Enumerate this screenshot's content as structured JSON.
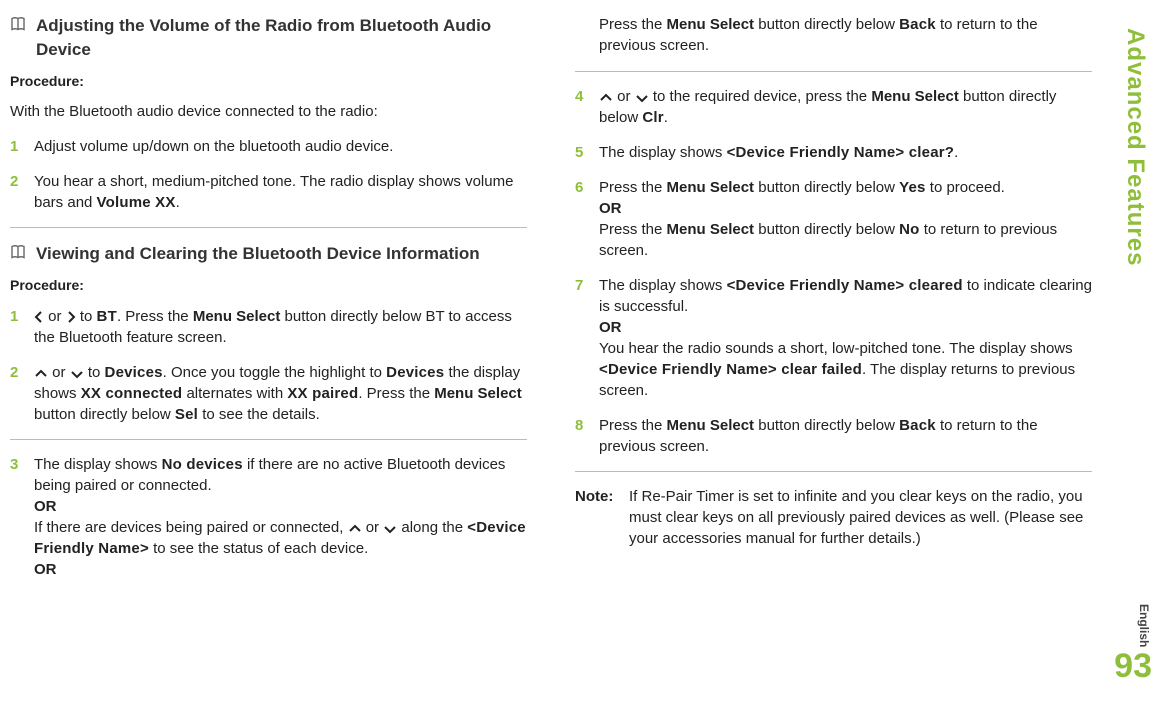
{
  "sideTab": "Advanced Features",
  "langTag": "English",
  "pageNumber": "93",
  "icons": {
    "book": "book-icon",
    "left": "nav-left-caret-icon",
    "right": "nav-right-caret-icon",
    "up": "nav-up-caret-icon",
    "down": "nav-down-caret-icon"
  },
  "col1": {
    "section1": {
      "title": "Adjusting the Volume of the Radio from Bluetooth Audio Device",
      "procLabel": "Procedure:",
      "intro": "With the Bluetooth audio device connected to the radio:",
      "steps": [
        {
          "n": "1",
          "parts": [
            "Adjust volume up/down on the bluetooth audio device."
          ]
        },
        {
          "n": "2",
          "parts": [
            "You hear a short, medium-pitched tone. The radio display shows volume bars and ",
            {
              "ui": "Volume XX"
            },
            "."
          ]
        }
      ]
    },
    "section2": {
      "title": "Viewing and Clearing the Bluetooth Device Information",
      "procLabel": "Procedure:",
      "steps": [
        {
          "n": "1",
          "parts": [
            {
              "icon": "left"
            },
            " or ",
            {
              "icon": "right"
            },
            " to ",
            {
              "ui": "BT"
            },
            ". Press the ",
            {
              "b": "Menu Select"
            },
            " button directly below BT to access the Bluetooth feature screen."
          ]
        },
        {
          "n": "2",
          "parts": [
            {
              "icon": "up"
            },
            " or ",
            {
              "icon": "down"
            },
            " to ",
            {
              "ui": "Devices"
            },
            ". Once you toggle the highlight to ",
            {
              "ui": "Devices"
            },
            " the display shows ",
            {
              "ui": "XX connected"
            },
            " alternates with ",
            {
              "ui": "XX paired"
            },
            ". Press the ",
            {
              "b": "Menu Select"
            },
            " button directly below ",
            {
              "ui": "Sel"
            },
            " to see the details."
          ]
        },
        {
          "n": "3",
          "parts": [
            "The display shows ",
            {
              "ui": "No devices"
            },
            " if there are no active Bluetooth devices being paired or connected.",
            {
              "br": true
            },
            {
              "b": "OR"
            },
            {
              "br": true
            },
            "If there are devices being paired or connected, ",
            {
              "icon": "up"
            },
            " or ",
            {
              "icon": "down"
            },
            " along the ",
            {
              "ui": "<Device Friendly Name>"
            },
            " to see the status of each device.",
            {
              "br": true
            },
            {
              "b": "OR"
            }
          ]
        }
      ]
    }
  },
  "col2": {
    "leadIn": {
      "parts": [
        "Press the ",
        {
          "b": "Menu Select"
        },
        " button directly below ",
        {
          "ui": "Back"
        },
        " to return to the previous screen."
      ]
    },
    "steps": [
      {
        "n": "4",
        "parts": [
          {
            "icon": "up"
          },
          " or ",
          {
            "icon": "down"
          },
          " to the required device, press the ",
          {
            "b": "Menu Select"
          },
          " button directly below ",
          {
            "ui": "Clr"
          },
          "."
        ]
      },
      {
        "n": "5",
        "parts": [
          "The display shows ",
          {
            "ui": "<Device Friendly Name> clear?"
          },
          "."
        ]
      },
      {
        "n": "6",
        "parts": [
          "Press the ",
          {
            "b": "Menu Select"
          },
          " button directly below ",
          {
            "ui": "Yes"
          },
          " to proceed.",
          {
            "br": true
          },
          {
            "b": "OR"
          },
          {
            "br": true
          },
          "Press the ",
          {
            "b": "Menu Select"
          },
          " button directly below ",
          {
            "ui": "No"
          },
          " to return to previous screen."
        ]
      },
      {
        "n": "7",
        "parts": [
          "The display shows ",
          {
            "ui": "<Device Friendly Name> cleared"
          },
          " to indicate clearing is successful.",
          {
            "br": true
          },
          {
            "b": "OR"
          },
          {
            "br": true
          },
          "You hear the radio sounds a short, low-pitched tone. The display shows ",
          {
            "ui": "<Device Friendly Name> clear failed"
          },
          ". The display returns to previous screen."
        ]
      },
      {
        "n": "8",
        "parts": [
          "Press the ",
          {
            "b": "Menu Select"
          },
          " button directly below ",
          {
            "ui": "Back"
          },
          " to return to the previous screen."
        ]
      }
    ],
    "note": {
      "label": "Note:",
      "body": "If Re-Pair Timer is set to infinite and you clear keys on the radio, you must clear keys on all previously paired devices as well. (Please see your accessories manual for further details.)"
    }
  }
}
